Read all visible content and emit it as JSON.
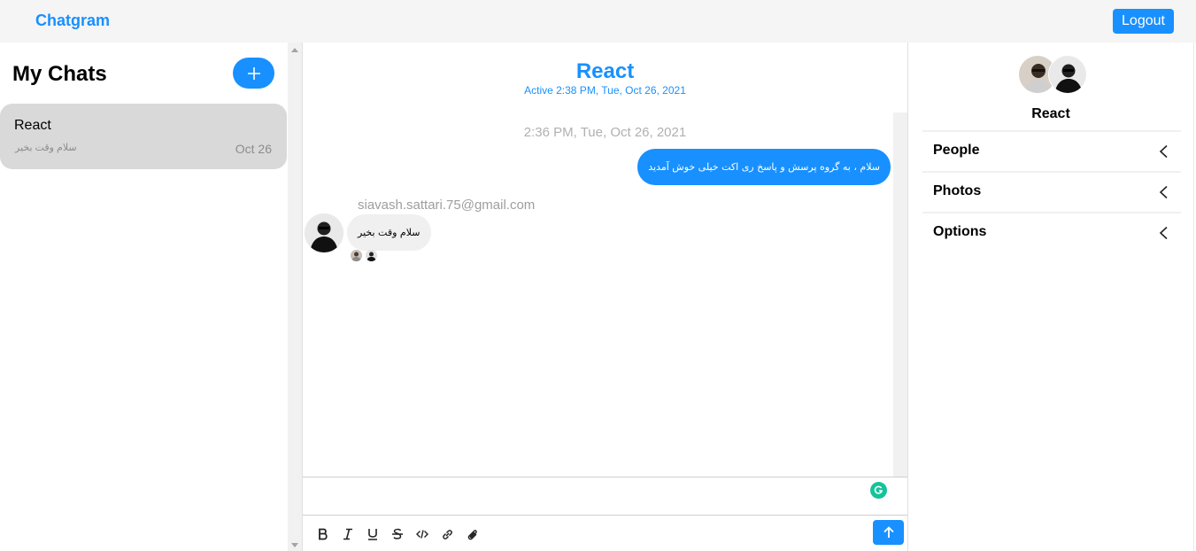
{
  "navbar": {
    "brand": "Chatgram",
    "logout_label": "Logout",
    "accent": "#1890ff"
  },
  "chat_list": {
    "title": "My Chats",
    "new_chat_icon": "plus-icon",
    "items": [
      {
        "title": "React",
        "preview": "سلام وقت بخیر",
        "date": "Oct 26"
      }
    ]
  },
  "feed": {
    "title": "React",
    "subtitle": "Active 2:38 PM, Tue, Oct 26, 2021",
    "timestamp": "2:36 PM, Tue, Oct 26, 2021",
    "my_message": "سلام ، به گروه پرسش و پاسخ ری اکت خیلی خوش آمدید",
    "their_sender": "siavash.sattari.75@gmail.com",
    "their_message": "سلام وقت بخیر"
  },
  "composer": {
    "toolbar_icons": [
      "bold-icon",
      "italic-icon",
      "underline-icon",
      "strikethrough-icon",
      "code-icon",
      "link-icon",
      "attachment-icon"
    ],
    "send_icon": "arrow-up-icon",
    "assist_icon": "grammarly-icon"
  },
  "settings": {
    "title": "React",
    "sections": [
      {
        "label": "People"
      },
      {
        "label": "Photos"
      },
      {
        "label": "Options"
      }
    ]
  }
}
